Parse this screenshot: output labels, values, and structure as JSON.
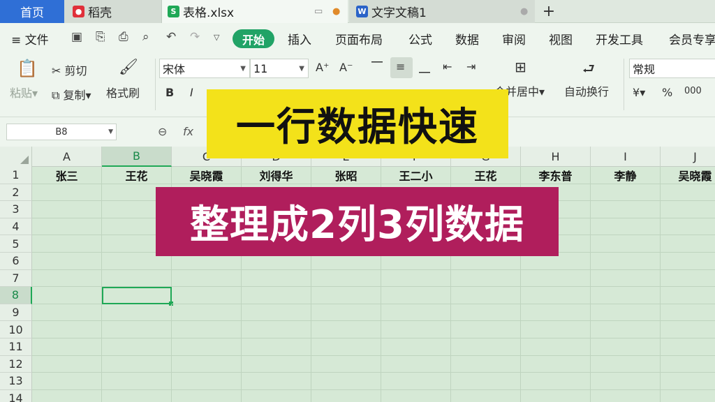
{
  "tabs": {
    "home": "首页",
    "daoke": "稻壳",
    "sheet": "表格.xlsx",
    "doc": "文字文稿1",
    "add": "+"
  },
  "menu": {
    "file": "文件",
    "items": [
      "开始",
      "插入",
      "页面布局",
      "公式",
      "数据",
      "审阅",
      "视图",
      "开发工具",
      "会员专享"
    ]
  },
  "ribbon": {
    "paste": "粘贴",
    "cut": "剪切",
    "copy": "复制",
    "format_painter": "格式刷",
    "font_name": "宋体",
    "font_size": "11",
    "merge": "合并居中",
    "wrap": "自动换行",
    "number_format": "常规",
    "currency": "¥",
    "percent": "%"
  },
  "formula": {
    "cell_ref": "B8",
    "fx": "fx"
  },
  "grid": {
    "columns": [
      "A",
      "B",
      "C",
      "D",
      "E",
      "F",
      "G",
      "H",
      "I",
      "J"
    ],
    "rows": [
      "1",
      "2",
      "3",
      "4",
      "5",
      "6",
      "7",
      "8",
      "9",
      "10",
      "11",
      "12",
      "13",
      "14"
    ],
    "row1": [
      "张三",
      "王花",
      "吴晓霞",
      "刘得华",
      "张昭",
      "王二小",
      "王花",
      "李东普",
      "李静",
      "吴晓霞"
    ],
    "selected_cell": "B8"
  },
  "overlay": {
    "line1": "一行数据快速",
    "line2": "整理成2列3列数据"
  },
  "colors": {
    "accent": "#21a366",
    "overlay1": "#f3e21a",
    "overlay2": "#b01e5c",
    "home_tab": "#2f6fd6"
  }
}
